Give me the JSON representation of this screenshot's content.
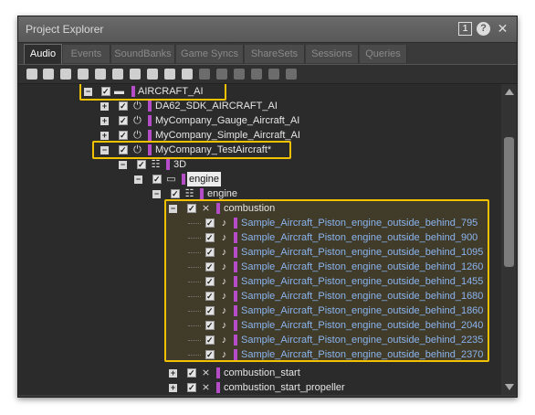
{
  "window": {
    "title": "Project Explorer",
    "num_button": "1",
    "help_button": "?",
    "close_button": "✕"
  },
  "tabs": [
    {
      "label": "Audio",
      "active": true
    },
    {
      "label": "Events"
    },
    {
      "label": "SoundBanks"
    },
    {
      "label": "Game Syncs"
    },
    {
      "label": "ShareSets"
    },
    {
      "label": "Sessions"
    },
    {
      "label": "Queries"
    }
  ],
  "toolbar_icons": [
    "work-unit-icon",
    "folder-icon",
    "virtual-folder-icon",
    "actor-mixer-icon",
    "blend-container-icon",
    "random-container-icon",
    "sequence-container-icon",
    "switch-container-icon",
    "sound-sfx-icon",
    "sound-voice-icon",
    "music-segment-icon",
    "music-track-icon",
    "music-playlist-icon",
    "music-switch-icon",
    "music-segment-alt-icon"
  ],
  "tree": {
    "aircraft_ai": "AIRCRAFT_AI",
    "da62": "DA62_SDK_AIRCRAFT_AI",
    "gauge": "MyCompany_Gauge_Aircraft_AI",
    "simple": "MyCompany_Simple_Aircraft_AI",
    "test": "MyCompany_TestAircraft*",
    "threed": "3D",
    "engine_folder": "engine",
    "engine_mixer": "engine",
    "combustion": "combustion",
    "sounds": [
      "Sample_Aircraft_Piston_engine_outside_behind_795",
      "Sample_Aircraft_Piston_engine_outside_behind_900",
      "Sample_Aircraft_Piston_engine_outside_behind_1095",
      "Sample_Aircraft_Piston_engine_outside_behind_1260",
      "Sample_Aircraft_Piston_engine_outside_behind_1455",
      "Sample_Aircraft_Piston_engine_outside_behind_1680",
      "Sample_Aircraft_Piston_engine_outside_behind_1860",
      "Sample_Aircraft_Piston_engine_outside_behind_2040",
      "Sample_Aircraft_Piston_engine_outside_behind_2235",
      "Sample_Aircraft_Piston_engine_outside_behind_2370"
    ],
    "combustion_start": "combustion_start",
    "combustion_start_propeller": "combustion_start_propeller"
  },
  "colors": {
    "highlight": "#f2c200",
    "color_bar": "#b54cc8",
    "sound_text": "#8ab4f0"
  }
}
